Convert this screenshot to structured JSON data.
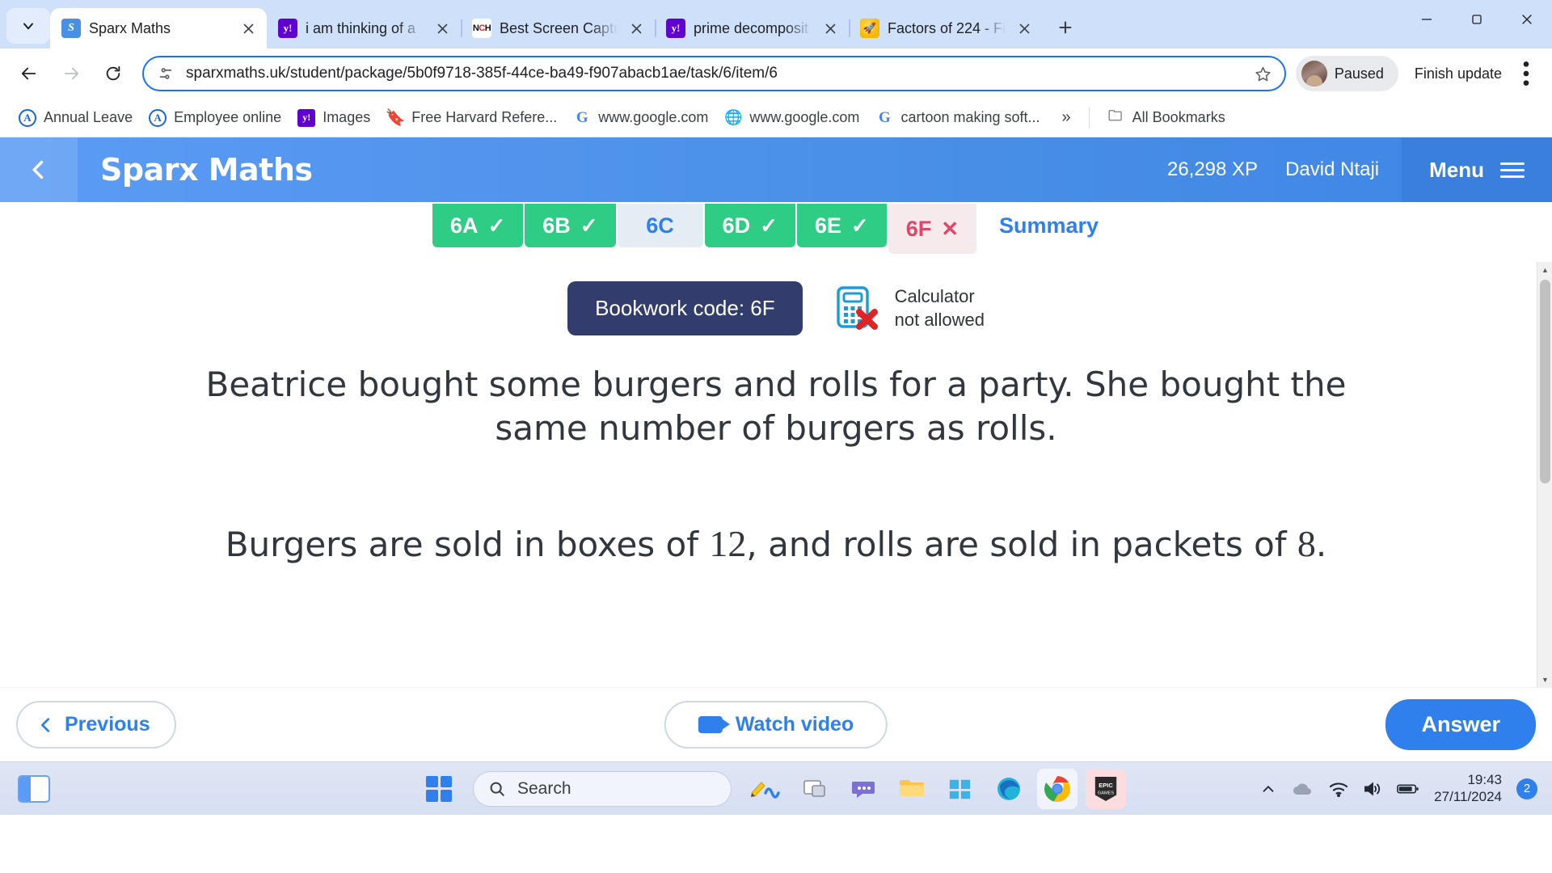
{
  "browser": {
    "tabs": [
      {
        "title": "Sparx Maths",
        "favicon": "sparx-icon",
        "active": true
      },
      {
        "title": "i am thinking of a",
        "favicon": "yahoo-icon",
        "active": false
      },
      {
        "title": "Best Screen Captu",
        "favicon": "nch-icon",
        "active": false
      },
      {
        "title": "prime decomposit",
        "favicon": "yahoo-icon",
        "active": false
      },
      {
        "title": "Factors of 224 - Fi",
        "favicon": "rocket-icon",
        "active": false
      }
    ],
    "new_tab_label": "+",
    "url": "sparxmaths.uk/student/package/5b0f9718-385f-44ce-ba49-f907abacb1ae/task/6/item/6",
    "profile_label": "Paused",
    "update_label": "Finish update",
    "bookmarks": [
      {
        "label": "Annual Leave",
        "icon": "circle-a-icon"
      },
      {
        "label": "Employee online",
        "icon": "circle-a-icon"
      },
      {
        "label": "Images",
        "icon": "yahoo-icon"
      },
      {
        "label": "Free Harvard Refere...",
        "icon": "bookmark-icon"
      },
      {
        "label": "www.google.com",
        "icon": "google-icon"
      },
      {
        "label": "www.google.com",
        "icon": "globe-icon"
      },
      {
        "label": "cartoon making soft...",
        "icon": "google-icon"
      }
    ],
    "bookmarks_overflow": "»",
    "all_bookmarks_label": "All Bookmarks"
  },
  "sparx": {
    "brand": "Sparx Maths",
    "xp": "26,298 XP",
    "user": "David Ntaji",
    "menu_label": "Menu",
    "task_tabs": [
      {
        "label": "6A",
        "state": "done",
        "mark": "✓"
      },
      {
        "label": "6B",
        "state": "done",
        "mark": "✓"
      },
      {
        "label": "6C",
        "state": "todo",
        "mark": ""
      },
      {
        "label": "6D",
        "state": "done",
        "mark": "✓"
      },
      {
        "label": "6E",
        "state": "done",
        "mark": "✓"
      },
      {
        "label": "6F",
        "state": "wrong",
        "mark": "✕"
      },
      {
        "label": "Summary",
        "state": "summary",
        "mark": ""
      }
    ],
    "bookwork_code": "Bookwork code: 6F",
    "calculator_line1": "Calculator",
    "calculator_line2": "not allowed",
    "question_part1": "Beatrice bought some burgers and rolls for a party. She bought the same number of burgers as rolls.",
    "question_part2_a": "Burgers are sold in boxes of ",
    "question_num1": "12",
    "question_part2_b": ", and rolls are sold in packets of ",
    "question_num2": "8",
    "question_part2_c": ".",
    "footer": {
      "previous_label": "Previous",
      "watch_video_label": "Watch video",
      "answer_label": "Answer"
    },
    "colors": {
      "header_blue": "#4a90e8",
      "done_green": "#2ecc84",
      "accent_blue": "#2f80ed",
      "bookwork_navy": "#323d6e",
      "wrong_red": "#e1456a"
    }
  },
  "taskbar": {
    "search_placeholder": "Search",
    "time": "19:43",
    "date": "27/11/2024",
    "notification_count": "2",
    "apps": [
      {
        "name": "widgets-icon"
      },
      {
        "name": "windows-start-icon"
      },
      {
        "name": "search-box"
      },
      {
        "name": "pencil-squiggle-icon"
      },
      {
        "name": "task-view-icon"
      },
      {
        "name": "chat-icon"
      },
      {
        "name": "file-explorer-icon"
      },
      {
        "name": "microsoft-store-icon"
      },
      {
        "name": "edge-icon"
      },
      {
        "name": "chrome-icon"
      },
      {
        "name": "epic-games-icon"
      }
    ],
    "epic_line1": "EPIC",
    "epic_line2": "GAMES"
  }
}
